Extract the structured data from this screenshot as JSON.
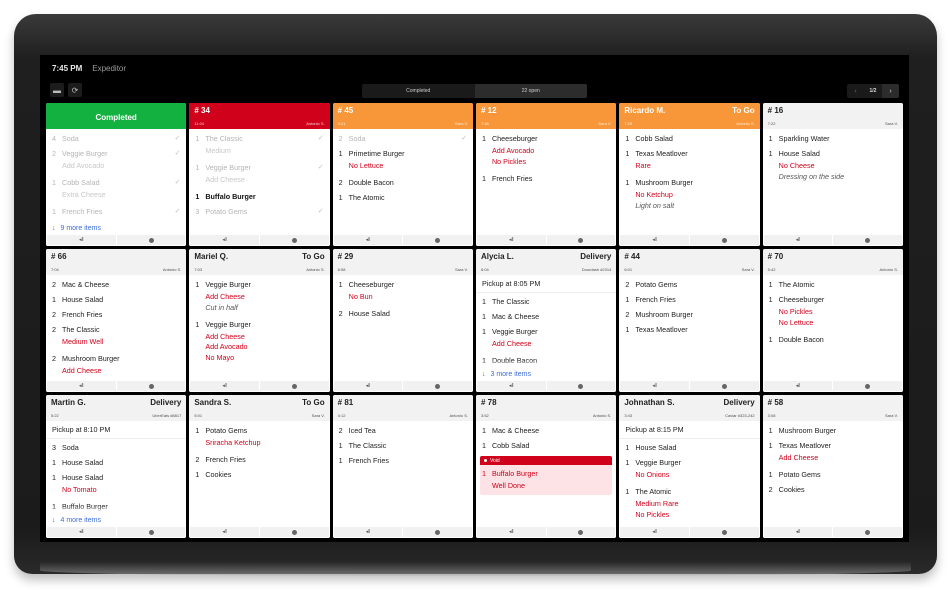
{
  "topbar": {
    "clock": "7:45 PM",
    "app_title": "Expeditor"
  },
  "toolbar": {
    "menu_icon": "menu-icon",
    "refresh_icon": "refresh-icon",
    "segments": [
      {
        "label": "Completed",
        "active": false
      },
      {
        "label": "22 open",
        "active": true
      }
    ],
    "pager": {
      "prev": "‹",
      "label": "1/2",
      "next": "›"
    }
  },
  "ticket_footer": {
    "recall_icon": "◂‖",
    "info_icon": "info-icon"
  },
  "tickets": [
    {
      "title": "Completed",
      "color": "green",
      "kind": "completed",
      "items": [
        {
          "qty": "4",
          "name": "Soda",
          "state": "done"
        },
        {
          "qty": "2",
          "name": "Veggie Burger",
          "state": "done",
          "mods": [
            "Add Avocado"
          ]
        },
        {
          "qty": "1",
          "name": "Cobb Salad",
          "state": "done",
          "mods": [
            "Extra Cheese"
          ]
        },
        {
          "qty": "1",
          "name": "French Fries",
          "state": "done"
        }
      ],
      "more": "9 more items"
    },
    {
      "title": "# 34",
      "time": "11:04",
      "server": "Antonio S.",
      "color": "red",
      "items": [
        {
          "qty": "1",
          "name": "The Classic",
          "state": "done",
          "mods": [
            "Medium"
          ]
        },
        {
          "qty": "1",
          "name": "Veggie Burger",
          "state": "done",
          "mods": [
            "Add Cheese"
          ]
        },
        {
          "qty": "1",
          "name": "Buffalo Burger",
          "state": "bold"
        },
        {
          "qty": "3",
          "name": "Potato Gems",
          "state": "done"
        }
      ]
    },
    {
      "title": "# 45",
      "time": "9:21",
      "server": "Sara V.",
      "color": "orange",
      "items": [
        {
          "qty": "2",
          "name": "Soda",
          "state": "done"
        },
        {
          "qty": "1",
          "name": "Primetime Burger",
          "mods": [
            "No Lettuce"
          ]
        },
        {
          "qty": "2",
          "name": "Double Bacon"
        },
        {
          "qty": "1",
          "name": "The Atomic"
        }
      ]
    },
    {
      "title": "# 12",
      "time": "7:46",
      "server": "Sara V.",
      "color": "orange",
      "items": [
        {
          "qty": "1",
          "name": "Cheeseburger",
          "mods": [
            "Add Avocado",
            "No Pickles"
          ]
        },
        {
          "qty": "1",
          "name": "French Fries"
        }
      ]
    },
    {
      "title": "Ricardo M.",
      "type": "To Go",
      "time": "7:29",
      "server": "Antonio S.",
      "color": "orange",
      "items": [
        {
          "qty": "1",
          "name": "Cobb Salad"
        },
        {
          "qty": "1",
          "name": "Texas Meatlover",
          "mods": [
            "Rare"
          ]
        },
        {
          "qty": "1",
          "name": "Mushroom Burger",
          "mods": [
            "No Ketchup"
          ],
          "note": "Light on salt"
        }
      ]
    },
    {
      "title": "# 16",
      "time": "7:22",
      "server": "Sara V.",
      "color": "gray",
      "items": [
        {
          "qty": "1",
          "name": "Sparkling Water"
        },
        {
          "qty": "1",
          "name": "House Salad",
          "mods": [
            "No Cheese"
          ],
          "note": "Dressing on the side"
        }
      ]
    },
    {
      "title": "# 66",
      "time": "7:04",
      "server": "Antonio S.",
      "color": "gray",
      "items": [
        {
          "qty": "2",
          "name": "Mac & Cheese"
        },
        {
          "qty": "1",
          "name": "House Salad"
        },
        {
          "qty": "2",
          "name": "French Fries"
        },
        {
          "qty": "2",
          "name": "The Classic",
          "mods": [
            "Medium Well"
          ]
        },
        {
          "qty": "2",
          "name": "Mushroom Burger",
          "mods": [
            "Add Cheese"
          ]
        }
      ]
    },
    {
      "title": "Mariel Q.",
      "type": "To Go",
      "time": "7:03",
      "server": "Antonio S.",
      "color": "gray",
      "items": [
        {
          "qty": "1",
          "name": "Veggie Burger",
          "mods": [
            "Add Cheese"
          ],
          "note": "Cut in half"
        },
        {
          "qty": "1",
          "name": "Veggie Burger",
          "mods": [
            "Add Cheese",
            "Add Avocado",
            "No Mayo"
          ]
        }
      ]
    },
    {
      "title": "# 29",
      "time": "6:58",
      "server": "Sara V.",
      "color": "gray",
      "items": [
        {
          "qty": "1",
          "name": "Cheeseburger",
          "mods": [
            "No Bun"
          ]
        },
        {
          "qty": "2",
          "name": "House Salad"
        }
      ]
    },
    {
      "title": "Alycia L.",
      "type": "Delivery",
      "time": "6:04",
      "server": "Doordash #2314",
      "color": "gray",
      "pickup": "Pickup at 8:05 PM",
      "items": [
        {
          "qty": "1",
          "name": "The Classic"
        },
        {
          "qty": "1",
          "name": "Mac & Cheese"
        },
        {
          "qty": "1",
          "name": "Veggie Burger",
          "mods": [
            "Add Cheese"
          ]
        },
        {
          "qty": "1",
          "name": "Double Bacon"
        }
      ],
      "more": "3 more items"
    },
    {
      "title": "# 44",
      "time": "6:01",
      "server": "Sara V.",
      "color": "gray",
      "items": [
        {
          "qty": "2",
          "name": "Potato Gems"
        },
        {
          "qty": "1",
          "name": "French Fries"
        },
        {
          "qty": "2",
          "name": "Mushroom Burger"
        },
        {
          "qty": "1",
          "name": "Texas Meatlover"
        }
      ]
    },
    {
      "title": "# 70",
      "time": "5:42",
      "server": "Antonio S.",
      "color": "gray",
      "items": [
        {
          "qty": "1",
          "name": "The Atomic"
        },
        {
          "qty": "1",
          "name": "Cheeseburger",
          "mods": [
            "No Pickles",
            "No Lettuce"
          ]
        },
        {
          "qty": "1",
          "name": "Double Bacon"
        }
      ]
    },
    {
      "title": "Martin G.",
      "type": "Delivery",
      "time": "5:22",
      "server": "UberEats #8817",
      "color": "gray",
      "pickup": "Pickup at 8:10 PM",
      "items": [
        {
          "qty": "3",
          "name": "Soda"
        },
        {
          "qty": "1",
          "name": "House Salad"
        },
        {
          "qty": "1",
          "name": "House Salad",
          "mods": [
            "No Tomato"
          ]
        },
        {
          "qty": "1",
          "name": "Buffalo Burger"
        }
      ],
      "more": "4 more items"
    },
    {
      "title": "Sandra S.",
      "type": "To Go",
      "time": "5:01",
      "server": "Sara V.",
      "color": "gray",
      "items": [
        {
          "qty": "1",
          "name": "Potato Gems",
          "mods": [
            "Sriracha Ketchup"
          ]
        },
        {
          "qty": "2",
          "name": "French Fries"
        },
        {
          "qty": "1",
          "name": "Cookies"
        }
      ]
    },
    {
      "title": "# 81",
      "time": "4:12",
      "server": "Antonio S.",
      "color": "gray",
      "items": [
        {
          "qty": "2",
          "name": "Iced Tea"
        },
        {
          "qty": "1",
          "name": "The Classic"
        },
        {
          "qty": "1",
          "name": "French Fries"
        }
      ]
    },
    {
      "title": "# 78",
      "time": "3:52",
      "server": "Antonio S.",
      "color": "gray",
      "items": [
        {
          "qty": "1",
          "name": "Mac & Cheese"
        },
        {
          "qty": "1",
          "name": "Cobb Salad"
        }
      ],
      "void": {
        "label": "Void",
        "qty": "1",
        "name": "Buffalo Burger",
        "mods": [
          "Well Done"
        ]
      }
    },
    {
      "title": "Johnathan S.",
      "type": "Delivery",
      "time": "3:43",
      "server": "Caviar #323-242",
      "color": "gray",
      "pickup": "Pickup at 8:15 PM",
      "items": [
        {
          "qty": "1",
          "name": "House Salad"
        },
        {
          "qty": "1",
          "name": "Veggie Burger",
          "mods": [
            "No Onions"
          ]
        },
        {
          "qty": "1",
          "name": "The Atomic",
          "mods": [
            "Medium Rare",
            "No Pickles"
          ]
        }
      ]
    },
    {
      "title": "# 58",
      "time": "3:08",
      "server": "Sara V.",
      "color": "gray",
      "items": [
        {
          "qty": "1",
          "name": "Mushroom Burger"
        },
        {
          "qty": "1",
          "name": "Texas Meatlover",
          "mods": [
            "Add Cheese"
          ]
        },
        {
          "qty": "1",
          "name": "Potato Gems"
        },
        {
          "qty": "2",
          "name": "Cookies"
        }
      ]
    }
  ],
  "colors": {
    "green": "#13b13f",
    "red": "#d0021b",
    "orange": "#f7973a",
    "link_blue": "#3d6ddb"
  }
}
